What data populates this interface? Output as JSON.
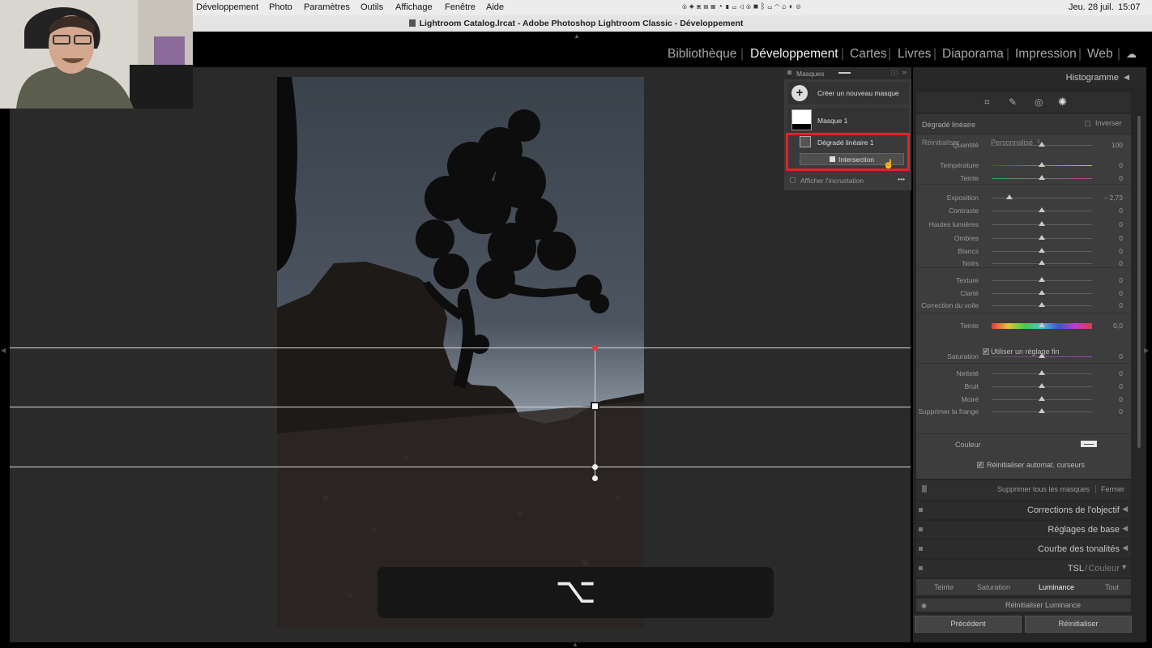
{
  "menubar": {
    "items": [
      "Développement",
      "Photo",
      "Paramètres",
      "Outils",
      "Affichage",
      "Fenêtre",
      "Aide"
    ],
    "date": "Jeu. 28 juil.",
    "time": "15:07"
  },
  "window": {
    "title": "Lightroom Catalog.lrcat - Adobe Photoshop Lightroom Classic - Développement"
  },
  "modules": {
    "items": [
      "Bibliothèque",
      "Développement",
      "Cartes",
      "Livres",
      "Diaporama",
      "Impression",
      "Web"
    ],
    "active": "Développement"
  },
  "masks": {
    "title": "Masques",
    "create_label": "Créer un nouveau masque",
    "mask1_label": "Masque 1",
    "gradient_label": "Dégradé linéaire 1",
    "intersection_label": "Intersection",
    "overlay_label": "Afficher l'incrustation",
    "more": "•••"
  },
  "right_panel": {
    "histogram_label": "Histogramme",
    "section_title": "Dégradé linéaire",
    "invert_label": "Inverser",
    "reset_label": "Réinitialiser",
    "preset_label": "Personnalisé",
    "sliders": [
      {
        "label": "Quantité",
        "value": "100",
        "pos": 0.5
      },
      {
        "label": "Température",
        "value": "0",
        "pos": 0.5
      },
      {
        "label": "Teinte",
        "value": "0",
        "pos": 0.5
      },
      {
        "label": "Exposition",
        "value": "– 2,73",
        "pos": 0.18
      },
      {
        "label": "Contraste",
        "value": "0",
        "pos": 0.5
      },
      {
        "label": "Hautes lumières",
        "value": "0",
        "pos": 0.5
      },
      {
        "label": "Ombres",
        "value": "0",
        "pos": 0.5
      },
      {
        "label": "Blancs",
        "value": "0",
        "pos": 0.5
      },
      {
        "label": "Noirs",
        "value": "0",
        "pos": 0.5
      },
      {
        "label": "Texture",
        "value": "0",
        "pos": 0.5
      },
      {
        "label": "Clarté",
        "value": "0",
        "pos": 0.5
      },
      {
        "label": "Correction du voile",
        "value": "0",
        "pos": 0.5
      },
      {
        "label": "Teinte",
        "value": "0,0",
        "pos": 0.5
      },
      {
        "label": "Saturation",
        "value": "0",
        "pos": 0.5
      },
      {
        "label": "Netteté",
        "value": "0",
        "pos": 0.5
      },
      {
        "label": "Bruit",
        "value": "0",
        "pos": 0.5
      },
      {
        "label": "Moiré",
        "value": "0",
        "pos": 0.5
      },
      {
        "label": "Supprimer la frange",
        "value": "0",
        "pos": 0.5
      }
    ],
    "fine_tune_label": "Utiliser un réglage fin",
    "color_label": "Couleur",
    "auto_reset_label": "Réinitialiser automat. curseurs",
    "delete_all_label": "Supprimer tous les masques",
    "close_label": "Fermer",
    "lens_label": "Corrections de l'objectif",
    "basic_label": "Réglages de base",
    "curve_label": "Courbe des tonalités",
    "hsl_label": "TSL",
    "color_sep": "Couleur",
    "hsl_tabs": [
      "Teinte",
      "Saturation",
      "Luminance",
      "Tout"
    ],
    "hsl_active": "Luminance",
    "reset_lum_label": "Réinitialiser Luminance",
    "prev_label": "Précédent",
    "reset_button_label": "Réinitialiser"
  },
  "overlay": {
    "key_symbol": "⌥"
  }
}
